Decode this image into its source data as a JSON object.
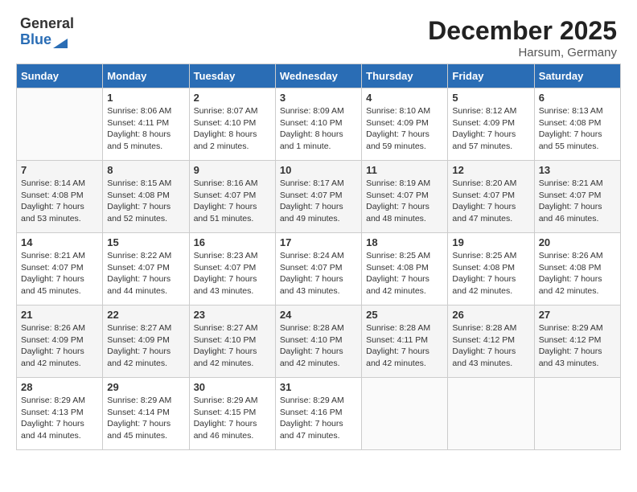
{
  "header": {
    "logo_general": "General",
    "logo_blue": "Blue",
    "title": "December 2025",
    "location": "Harsum, Germany"
  },
  "days_of_week": [
    "Sunday",
    "Monday",
    "Tuesday",
    "Wednesday",
    "Thursday",
    "Friday",
    "Saturday"
  ],
  "weeks": [
    [
      {
        "day": "",
        "info": ""
      },
      {
        "day": "1",
        "info": "Sunrise: 8:06 AM\nSunset: 4:11 PM\nDaylight: 8 hours\nand 5 minutes."
      },
      {
        "day": "2",
        "info": "Sunrise: 8:07 AM\nSunset: 4:10 PM\nDaylight: 8 hours\nand 2 minutes."
      },
      {
        "day": "3",
        "info": "Sunrise: 8:09 AM\nSunset: 4:10 PM\nDaylight: 8 hours\nand 1 minute."
      },
      {
        "day": "4",
        "info": "Sunrise: 8:10 AM\nSunset: 4:09 PM\nDaylight: 7 hours\nand 59 minutes."
      },
      {
        "day": "5",
        "info": "Sunrise: 8:12 AM\nSunset: 4:09 PM\nDaylight: 7 hours\nand 57 minutes."
      },
      {
        "day": "6",
        "info": "Sunrise: 8:13 AM\nSunset: 4:08 PM\nDaylight: 7 hours\nand 55 minutes."
      }
    ],
    [
      {
        "day": "7",
        "info": "Sunrise: 8:14 AM\nSunset: 4:08 PM\nDaylight: 7 hours\nand 53 minutes."
      },
      {
        "day": "8",
        "info": "Sunrise: 8:15 AM\nSunset: 4:08 PM\nDaylight: 7 hours\nand 52 minutes."
      },
      {
        "day": "9",
        "info": "Sunrise: 8:16 AM\nSunset: 4:07 PM\nDaylight: 7 hours\nand 51 minutes."
      },
      {
        "day": "10",
        "info": "Sunrise: 8:17 AM\nSunset: 4:07 PM\nDaylight: 7 hours\nand 49 minutes."
      },
      {
        "day": "11",
        "info": "Sunrise: 8:19 AM\nSunset: 4:07 PM\nDaylight: 7 hours\nand 48 minutes."
      },
      {
        "day": "12",
        "info": "Sunrise: 8:20 AM\nSunset: 4:07 PM\nDaylight: 7 hours\nand 47 minutes."
      },
      {
        "day": "13",
        "info": "Sunrise: 8:21 AM\nSunset: 4:07 PM\nDaylight: 7 hours\nand 46 minutes."
      }
    ],
    [
      {
        "day": "14",
        "info": "Sunrise: 8:21 AM\nSunset: 4:07 PM\nDaylight: 7 hours\nand 45 minutes."
      },
      {
        "day": "15",
        "info": "Sunrise: 8:22 AM\nSunset: 4:07 PM\nDaylight: 7 hours\nand 44 minutes."
      },
      {
        "day": "16",
        "info": "Sunrise: 8:23 AM\nSunset: 4:07 PM\nDaylight: 7 hours\nand 43 minutes."
      },
      {
        "day": "17",
        "info": "Sunrise: 8:24 AM\nSunset: 4:07 PM\nDaylight: 7 hours\nand 43 minutes."
      },
      {
        "day": "18",
        "info": "Sunrise: 8:25 AM\nSunset: 4:08 PM\nDaylight: 7 hours\nand 42 minutes."
      },
      {
        "day": "19",
        "info": "Sunrise: 8:25 AM\nSunset: 4:08 PM\nDaylight: 7 hours\nand 42 minutes."
      },
      {
        "day": "20",
        "info": "Sunrise: 8:26 AM\nSunset: 4:08 PM\nDaylight: 7 hours\nand 42 minutes."
      }
    ],
    [
      {
        "day": "21",
        "info": "Sunrise: 8:26 AM\nSunset: 4:09 PM\nDaylight: 7 hours\nand 42 minutes."
      },
      {
        "day": "22",
        "info": "Sunrise: 8:27 AM\nSunset: 4:09 PM\nDaylight: 7 hours\nand 42 minutes."
      },
      {
        "day": "23",
        "info": "Sunrise: 8:27 AM\nSunset: 4:10 PM\nDaylight: 7 hours\nand 42 minutes."
      },
      {
        "day": "24",
        "info": "Sunrise: 8:28 AM\nSunset: 4:10 PM\nDaylight: 7 hours\nand 42 minutes."
      },
      {
        "day": "25",
        "info": "Sunrise: 8:28 AM\nSunset: 4:11 PM\nDaylight: 7 hours\nand 42 minutes."
      },
      {
        "day": "26",
        "info": "Sunrise: 8:28 AM\nSunset: 4:12 PM\nDaylight: 7 hours\nand 43 minutes."
      },
      {
        "day": "27",
        "info": "Sunrise: 8:29 AM\nSunset: 4:12 PM\nDaylight: 7 hours\nand 43 minutes."
      }
    ],
    [
      {
        "day": "28",
        "info": "Sunrise: 8:29 AM\nSunset: 4:13 PM\nDaylight: 7 hours\nand 44 minutes."
      },
      {
        "day": "29",
        "info": "Sunrise: 8:29 AM\nSunset: 4:14 PM\nDaylight: 7 hours\nand 45 minutes."
      },
      {
        "day": "30",
        "info": "Sunrise: 8:29 AM\nSunset: 4:15 PM\nDaylight: 7 hours\nand 46 minutes."
      },
      {
        "day": "31",
        "info": "Sunrise: 8:29 AM\nSunset: 4:16 PM\nDaylight: 7 hours\nand 47 minutes."
      },
      {
        "day": "",
        "info": ""
      },
      {
        "day": "",
        "info": ""
      },
      {
        "day": "",
        "info": ""
      }
    ]
  ]
}
